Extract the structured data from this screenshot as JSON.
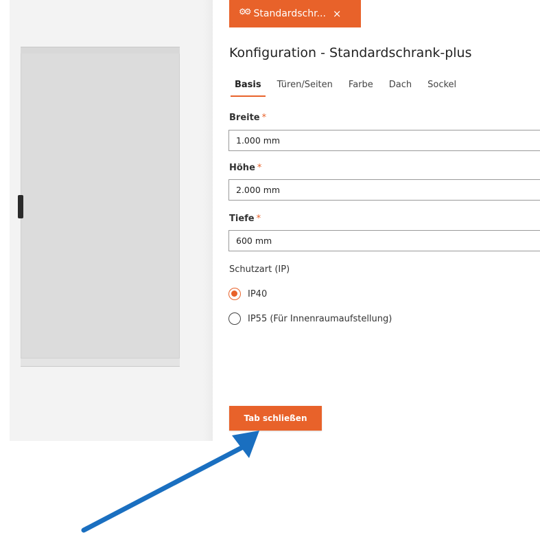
{
  "top_tab": {
    "icon": "gears-icon",
    "label": "Standardschr...",
    "close_icon": "close-icon",
    "close_glyph": "×"
  },
  "config": {
    "title": "Konfiguration - Standardschrank-plus"
  },
  "subtabs": [
    {
      "label": "Basis",
      "active": true
    },
    {
      "label": "Türen/Seiten",
      "active": false
    },
    {
      "label": "Farbe",
      "active": false
    },
    {
      "label": "Dach",
      "active": false
    },
    {
      "label": "Sockel",
      "active": false
    }
  ],
  "fields": {
    "width": {
      "label": "Breite",
      "required_mark": "*",
      "value": "1.000 mm"
    },
    "height": {
      "label": "Höhe",
      "required_mark": "*",
      "value": "2.000 mm"
    },
    "depth": {
      "label": "Tiefe",
      "required_mark": "*",
      "value": "600 mm"
    }
  },
  "protection": {
    "label": "Schutzart (IP)",
    "options": [
      {
        "label": "IP40",
        "checked": true
      },
      {
        "label": "IP55 (Für Innenraumaufstellung)",
        "checked": false
      }
    ]
  },
  "actions": {
    "close_tab_label": "Tab schließen"
  },
  "colors": {
    "accent": "#e8622a",
    "arrow": "#1a6fc0"
  }
}
